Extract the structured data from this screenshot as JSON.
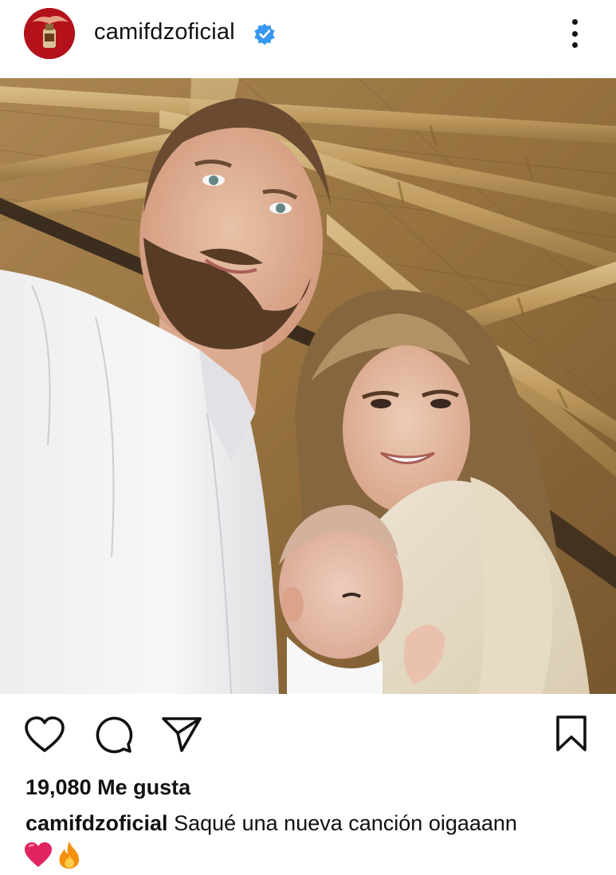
{
  "post": {
    "username": "camifdzoficial",
    "likes_text": "19,080 Me gusta",
    "caption_user": "camifdzoficial",
    "caption_text": "Saqué una nueva canción oigaaann",
    "caption_emojis": [
      "heart-emoji",
      "fire-emoji"
    ]
  },
  "icons": {
    "verified": "verified-badge-icon",
    "more": "more-options-icon",
    "like": "heart-icon",
    "comment": "comment-icon",
    "share": "send-icon",
    "save": "bookmark-icon"
  },
  "colors": {
    "verified_blue": "#3897f0",
    "heart_red": "#e0245e",
    "text": "#111111",
    "background": "#ffffff"
  }
}
